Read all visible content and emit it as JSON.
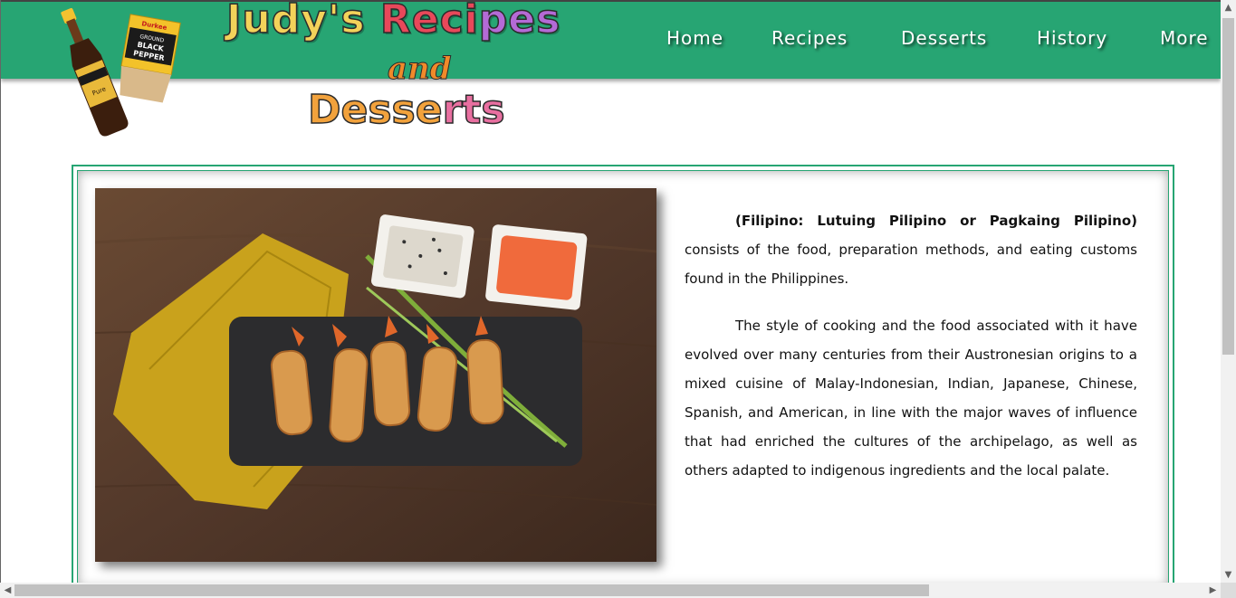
{
  "site": {
    "logo": {
      "line1_a": "Judy's ",
      "line1_b": "Reci",
      "line1_c": "pes",
      "line2": "and",
      "line3_a": "Desse",
      "line3_b": "rts"
    },
    "bottle_label": "Pure",
    "pepper_box": {
      "brand": "Durkee",
      "line1": "GROUND",
      "line2": "BLACK",
      "line3": "PEPPER"
    }
  },
  "nav": {
    "items": [
      {
        "label": "Home"
      },
      {
        "label": "Recipes"
      },
      {
        "label": "Desserts"
      },
      {
        "label": "History"
      },
      {
        "label": "More"
      }
    ]
  },
  "article": {
    "lead": "(Filipino: Lutuing Pilipino or Pagkaing Pilipino)",
    "p1_rest": " consists of the food, preparation methods, and eating customs found in the Philippines.",
    "p2": "The style of cooking and the food associated with it have evolved over many centuries from their Austronesian origins to a mixed cuisine of Malay-Indonesian, Indian, Japanese, Chinese, Spanish, and American, in line with the major waves of influence that had enriched the cultures of the archipelago, as well as others adapted to indigenous ingredients and the local palate."
  },
  "colors": {
    "header": "#27a573",
    "frame": "#27a573",
    "nav_text": "#ffffff"
  }
}
